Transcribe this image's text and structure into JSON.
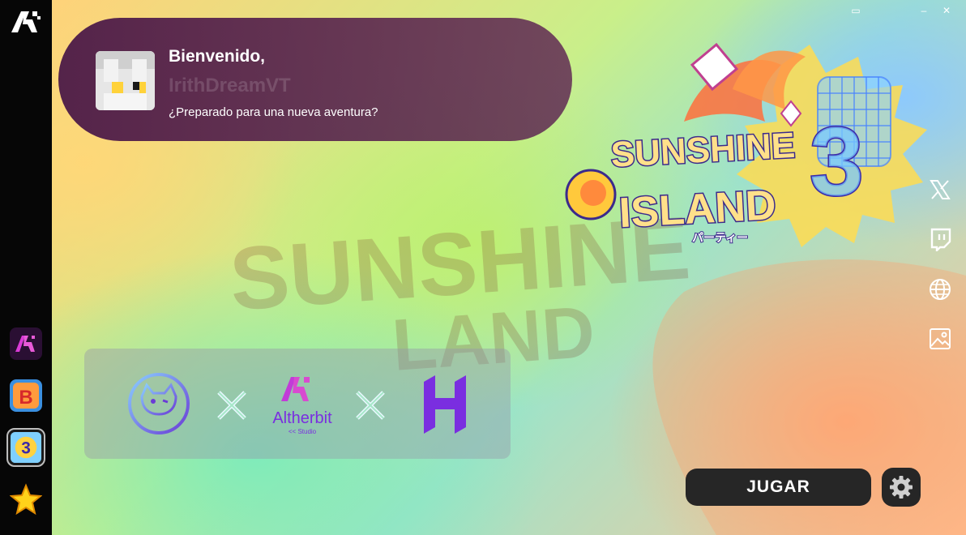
{
  "window": {
    "restore_glyph": "▭",
    "minimize_glyph": "–",
    "close_glyph": "✕"
  },
  "sidebar": {
    "logo_icon": "altherbit-logo-icon",
    "items": [
      {
        "name": "altherbit-studio",
        "icon": "altherbit-studio-icon"
      },
      {
        "name": "game-b",
        "icon": "game-b-icon"
      },
      {
        "name": "sunshine-island-3",
        "icon": "sunshine-island-3-icon",
        "active": true
      },
      {
        "name": "star-game",
        "icon": "star-icon"
      }
    ]
  },
  "welcome": {
    "title": "Bienvenido,",
    "username": "IrithDreamVT",
    "subtitle": "¿Preparado para una nueva aventura?"
  },
  "game": {
    "logo_line1": "SUNSHINE",
    "logo_line2": "ISLAND",
    "logo_sub": "パーティー",
    "bg_line1": "SUNSHINE",
    "bg_line2": "LAND"
  },
  "partners": {
    "separator": "×",
    "altherbit_name": "Altherbit",
    "altherbit_tag": "<< Studio"
  },
  "social": [
    "x-icon",
    "twitch-icon",
    "globe-icon",
    "image-icon"
  ],
  "actions": {
    "play_label": "JUGAR"
  },
  "colors": {
    "play_bg": "#262626",
    "accent_purple": "#7a2ee0"
  }
}
